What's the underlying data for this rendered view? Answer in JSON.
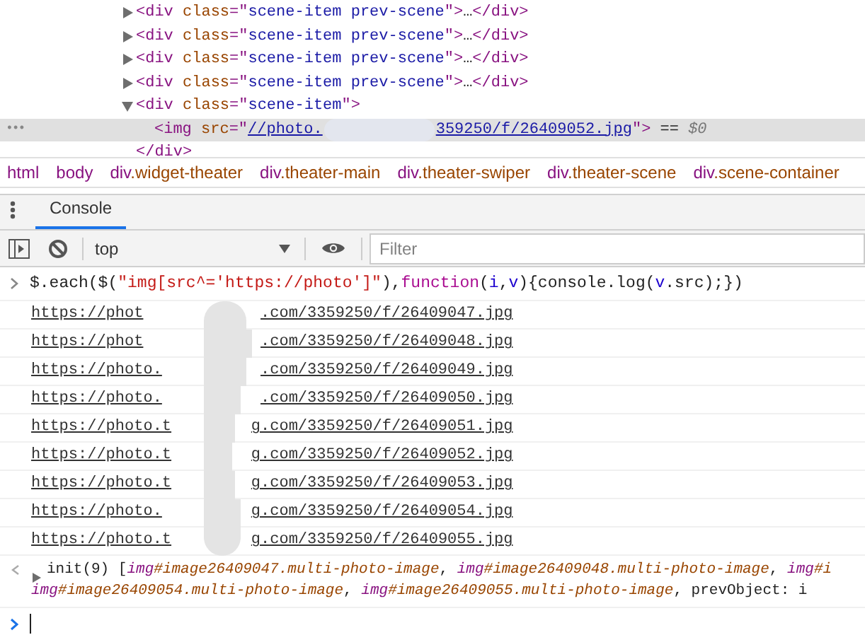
{
  "elements_tree": [
    {
      "expanded": false,
      "selected": false,
      "tokens": [
        {
          "kind": "tag",
          "s": "<div "
        },
        {
          "kind": "attr",
          "s": "class"
        },
        {
          "kind": "punct",
          "s": "=\""
        },
        {
          "kind": "value",
          "s": "scene-item prev-scene"
        },
        {
          "kind": "punct",
          "s": "\">"
        },
        {
          "kind": "plain",
          "s": "…"
        },
        {
          "kind": "tag",
          "s": "</div>"
        }
      ]
    },
    {
      "expanded": false,
      "selected": false,
      "tokens": [
        {
          "kind": "tag",
          "s": "<div "
        },
        {
          "kind": "attr",
          "s": "class"
        },
        {
          "kind": "punct",
          "s": "=\""
        },
        {
          "kind": "value",
          "s": "scene-item prev-scene"
        },
        {
          "kind": "punct",
          "s": "\">"
        },
        {
          "kind": "plain",
          "s": "…"
        },
        {
          "kind": "tag",
          "s": "</div>"
        }
      ]
    },
    {
      "expanded": false,
      "selected": false,
      "tokens": [
        {
          "kind": "tag",
          "s": "<div "
        },
        {
          "kind": "attr",
          "s": "class"
        },
        {
          "kind": "punct",
          "s": "=\""
        },
        {
          "kind": "value",
          "s": "scene-item prev-scene"
        },
        {
          "kind": "punct",
          "s": "\">"
        },
        {
          "kind": "plain",
          "s": "…"
        },
        {
          "kind": "tag",
          "s": "</div>"
        }
      ]
    },
    {
      "expanded": false,
      "selected": false,
      "tokens": [
        {
          "kind": "tag",
          "s": "<div "
        },
        {
          "kind": "attr",
          "s": "class"
        },
        {
          "kind": "punct",
          "s": "=\""
        },
        {
          "kind": "value",
          "s": "scene-item prev-scene"
        },
        {
          "kind": "punct",
          "s": "\">"
        },
        {
          "kind": "plain",
          "s": "…"
        },
        {
          "kind": "tag",
          "s": "</div>"
        }
      ]
    },
    {
      "expanded": true,
      "selected": false,
      "tokens": [
        {
          "kind": "tag",
          "s": "<div "
        },
        {
          "kind": "attr",
          "s": "class"
        },
        {
          "kind": "punct",
          "s": "=\""
        },
        {
          "kind": "value",
          "s": "scene-item"
        },
        {
          "kind": "punct",
          "s": "\">"
        }
      ],
      "children": [
        {
          "selected": true,
          "gutter": "•••",
          "tokens": [
            {
              "kind": "tag",
              "s": "<img "
            },
            {
              "kind": "attr",
              "s": "src"
            },
            {
              "kind": "punct",
              "s": "=\""
            },
            {
              "kind": "link",
              "s": "//photo."
            }
          ],
          "tokens_after_blur": [
            {
              "kind": "link",
              "s": "359250/f/26409052.jpg"
            },
            {
              "kind": "punct",
              "s": "\">"
            },
            {
              "kind": "plain",
              "s": " == "
            },
            {
              "kind": "italic",
              "s": "$0"
            }
          ]
        }
      ]
    },
    {
      "selected": false,
      "tokens": [
        {
          "kind": "tag",
          "s": "</div>"
        }
      ]
    }
  ],
  "breadcrumbs": [
    "html",
    "body",
    "div.widget-theater",
    "div.theater-main",
    "div.theater-swiper",
    "div.theater-scene",
    "div.scene-container"
  ],
  "drawer_tabs": [
    {
      "label": "Console",
      "selected": true
    }
  ],
  "console_toolbar": {
    "context": "top",
    "filter_placeholder": "Filter"
  },
  "console": {
    "input": [
      {
        "kind": "plain",
        "s": "$.each($("
      },
      {
        "kind": "str",
        "s": "\"img[src^='https://photo']\""
      },
      {
        "kind": "plain",
        "s": "),"
      },
      {
        "kind": "kw",
        "s": "function"
      },
      {
        "kind": "plain",
        "s": "("
      },
      {
        "kind": "var",
        "s": "i"
      },
      {
        "kind": "plain",
        "s": ","
      },
      {
        "kind": "var",
        "s": "v"
      },
      {
        "kind": "plain",
        "s": "){console.log("
      },
      {
        "kind": "var",
        "s": "v"
      },
      {
        "kind": "plain",
        "s": ".src);})"
      }
    ],
    "logs": [
      {
        "start": "https://phot",
        "end": ".com/3359250/f/26409047.jpg"
      },
      {
        "start": "https://phot",
        "end": ".com/3359250/f/26409048.jpg"
      },
      {
        "start": "https://photo.",
        "end": ".com/3359250/f/26409049.jpg"
      },
      {
        "start": "https://photo.",
        "end": ".com/3359250/f/26409050.jpg"
      },
      {
        "start": "https://photo.t",
        "end": "g.com/3359250/f/26409051.jpg"
      },
      {
        "start": "https://photo.t",
        "end": "g.com/3359250/f/26409052.jpg"
      },
      {
        "start": "https://photo.t",
        "end": "g.com/3359250/f/26409053.jpg"
      },
      {
        "start": "https://photo.",
        "end": "g.com/3359250/f/26409054.jpg"
      },
      {
        "start": "https://photo.t",
        "end": "g.com/3359250/f/26409055.jpg"
      }
    ],
    "result": {
      "expanded": false,
      "lines": [
        [
          {
            "kind": "plain",
            "s": "init(9) ["
          },
          {
            "kind": "el",
            "s": "img"
          },
          {
            "kind": "sel",
            "s": "#image26409047.multi-photo-image"
          },
          {
            "kind": "plain",
            "s": ", "
          },
          {
            "kind": "el",
            "s": "img"
          },
          {
            "kind": "sel",
            "s": "#image26409048.multi-photo-image"
          },
          {
            "kind": "plain",
            "s": ", "
          },
          {
            "kind": "el",
            "s": "img"
          },
          {
            "kind": "sel",
            "s": "#i"
          }
        ],
        [
          {
            "kind": "el",
            "s": "img"
          },
          {
            "kind": "sel",
            "s": "#image26409054.multi-photo-image"
          },
          {
            "kind": "plain",
            "s": ", "
          },
          {
            "kind": "el",
            "s": "img"
          },
          {
            "kind": "sel",
            "s": "#image26409055.multi-photo-image"
          },
          {
            "kind": "plain",
            "s": ", prevObject: i"
          }
        ]
      ]
    }
  }
}
